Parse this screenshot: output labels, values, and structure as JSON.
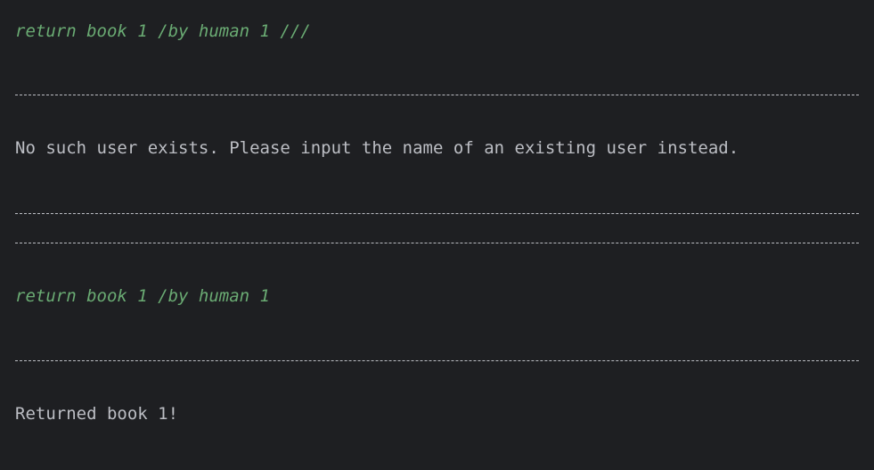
{
  "console": {
    "lines": [
      {
        "kind": "input",
        "text": "return book 1 /by human 1 ///"
      },
      {
        "kind": "output",
        "text": "No such user exists. Please input the name of an existing user instead."
      },
      {
        "kind": "input",
        "text": "return book 1 /by human 1"
      },
      {
        "kind": "output",
        "text": "Returned book 1!"
      }
    ]
  },
  "colors": {
    "background": "#1e1f22",
    "input_text": "#6aab73",
    "output_text": "#bcbec4"
  }
}
